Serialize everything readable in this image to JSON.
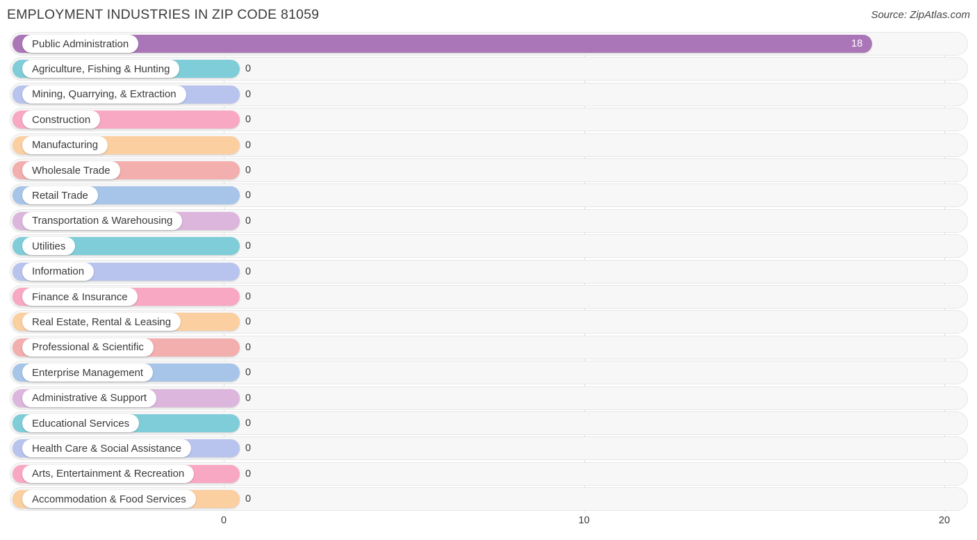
{
  "header": {
    "title": "EMPLOYMENT INDUSTRIES IN ZIP CODE 81059",
    "source": "Source: ZipAtlas.com"
  },
  "chart_data": {
    "type": "bar",
    "orientation": "horizontal",
    "title": "EMPLOYMENT INDUSTRIES IN ZIP CODE 81059",
    "xlabel": "",
    "ylabel": "",
    "xlim": [
      0,
      20
    ],
    "ticks": [
      "0",
      "10",
      "20"
    ],
    "tick_values": [
      0,
      10,
      20
    ],
    "grid": true,
    "legend": "none",
    "categories": [
      "Public Administration",
      "Agriculture, Fishing & Hunting",
      "Mining, Quarrying, & Extraction",
      "Construction",
      "Manufacturing",
      "Wholesale Trade",
      "Retail Trade",
      "Transportation & Warehousing",
      "Utilities",
      "Information",
      "Finance & Insurance",
      "Real Estate, Rental & Leasing",
      "Professional & Scientific",
      "Enterprise Management",
      "Administrative & Support",
      "Educational Services",
      "Health Care & Social Assistance",
      "Arts, Entertainment & Recreation",
      "Accommodation & Food Services"
    ],
    "values": [
      18,
      0,
      0,
      0,
      0,
      0,
      0,
      0,
      0,
      0,
      0,
      0,
      0,
      0,
      0,
      0,
      0,
      0,
      0
    ],
    "value_labels": [
      "18",
      "0",
      "0",
      "0",
      "0",
      "0",
      "0",
      "0",
      "0",
      "0",
      "0",
      "0",
      "0",
      "0",
      "0",
      "0",
      "0",
      "0",
      "0"
    ],
    "colors": [
      "#ab76b8",
      "#7fcdd8",
      "#b8c4ee",
      "#f9a8c4",
      "#fbcfa0",
      "#f3aeae",
      "#a7c5e8",
      "#dcb6dc",
      "#7fcdd8",
      "#b8c4ee",
      "#f9a8c4",
      "#fbcfa0",
      "#f3aeae",
      "#a7c5e8",
      "#dcb6dc",
      "#7fcdd8",
      "#b8c4ee",
      "#f9a8c4",
      "#fbcfa0"
    ]
  }
}
